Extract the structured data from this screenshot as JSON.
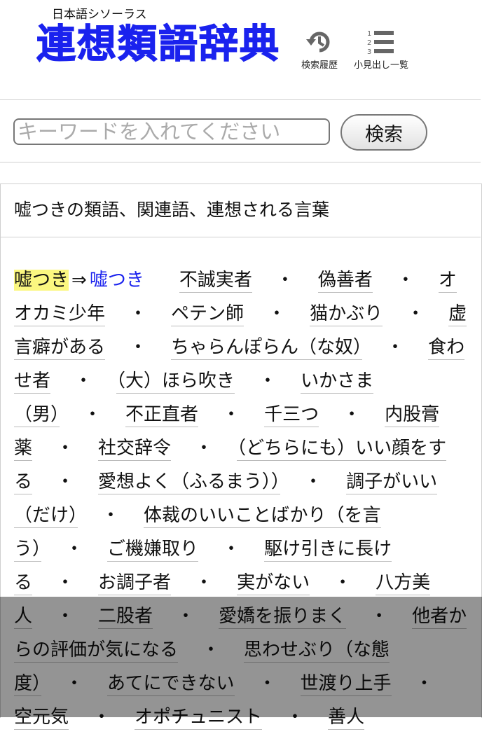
{
  "header": {
    "subtitle": "日本語シソーラス",
    "logo_text": "連想類語辞典",
    "history_label": "検索履歴",
    "outline_label": "小見出し一覧",
    "outline_icon_digits": [
      "1",
      "2",
      "3"
    ]
  },
  "search": {
    "placeholder": "キーワードを入れてください",
    "value": "",
    "button_label": "検索"
  },
  "result": {
    "title": "嘘つきの類語、関連語、連想される言葉",
    "head_word": "嘘つき",
    "arrow": "⇒",
    "head_link": "嘘つき",
    "separator": "・",
    "words": [
      "不誠実者",
      "偽善者",
      "オオカミ少年",
      "ペテン師",
      "猫かぶり",
      "虚言癖がある",
      "ちゃらんぽらん（な奴）",
      "食わせ者",
      "（大）ほら吹き",
      "いかさま（男）",
      "不正直者",
      "千三つ",
      "内股膏薬",
      "社交辞令",
      "（どちらにも）いい顔をする",
      "愛想よく（ふるまう））",
      "調子がいい（だけ）",
      "体裁のいいことばかり（を言う）",
      "ご機嫌取り",
      "駆け引きに長ける",
      "お調子者",
      "実がない",
      "八方美人",
      "二股者",
      "愛嬌を振りまく",
      "他者からの評価が気になる",
      "思わせぶり（な態度）",
      "あてにできない",
      "世渡り上手",
      "空元気",
      "オポチュニスト",
      "善人"
    ]
  },
  "colors": {
    "logo": "#1a22ee",
    "link": "#1a22ee",
    "highlight": "#fbf780"
  },
  "icons": {
    "history": "history-icon",
    "outline": "numbered-list-icon"
  }
}
